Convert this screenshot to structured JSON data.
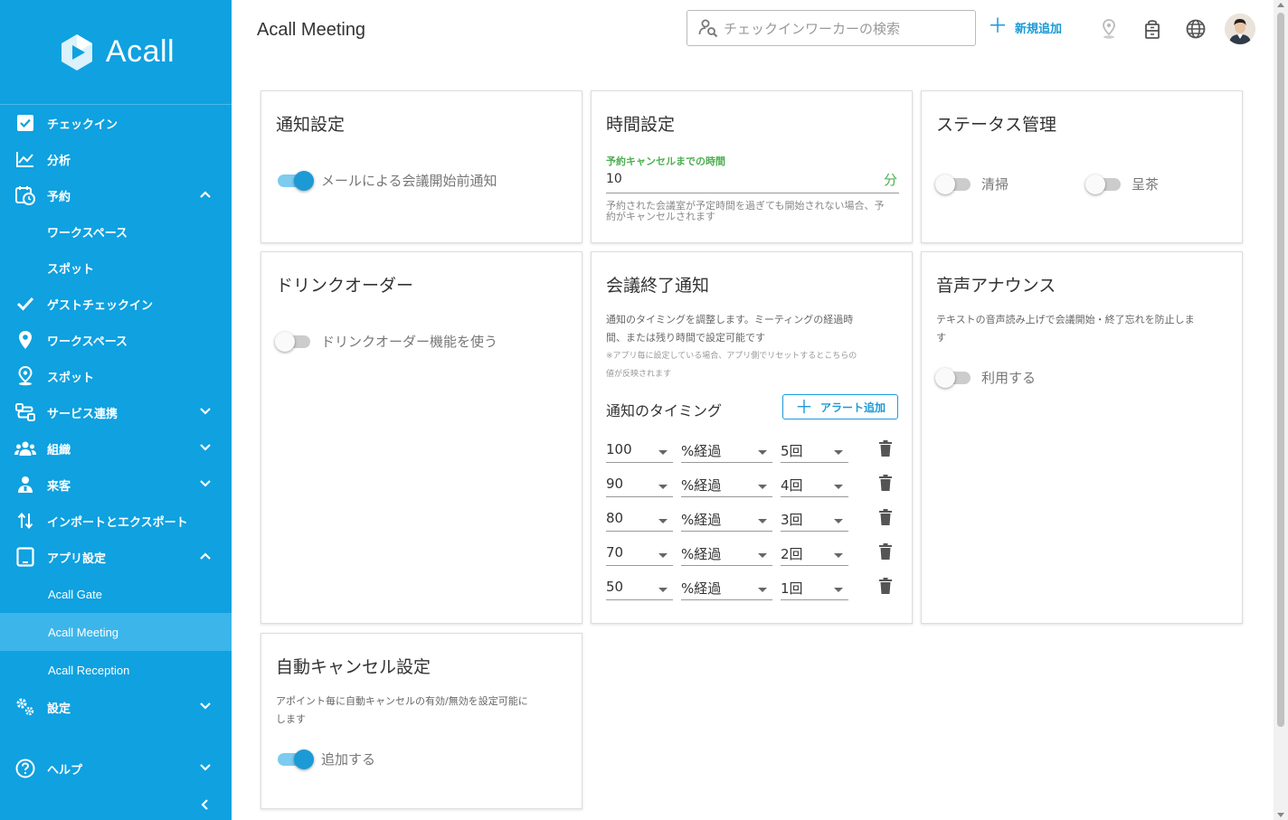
{
  "brand": {
    "name": "Acall",
    "color": "#0fa1e0"
  },
  "sidebar": {
    "items": [
      {
        "label": "チェックイン",
        "icon": "checkbox-icon"
      },
      {
        "label": "分析",
        "icon": "chart-line-icon"
      },
      {
        "label": "予約",
        "icon": "calendar-clock-icon",
        "expanded": true
      },
      {
        "label": "ワークスペース",
        "sub": true
      },
      {
        "label": "スポット",
        "sub": true
      },
      {
        "label": "ゲストチェックイン",
        "icon": "check-icon"
      },
      {
        "label": "ワークスペース",
        "icon": "map-pin-icon"
      },
      {
        "label": "スポット",
        "icon": "spot-pin-icon"
      },
      {
        "label": "サービス連携",
        "icon": "integration-icon",
        "expanded": false
      },
      {
        "label": "組織",
        "icon": "group-icon",
        "expanded": false
      },
      {
        "label": "来客",
        "icon": "visitor-icon",
        "expanded": false
      },
      {
        "label": "インポートとエクスポート",
        "icon": "import-export-icon"
      },
      {
        "label": "アプリ設定",
        "icon": "tablet-icon",
        "expanded": true
      },
      {
        "label": "Acall Gate",
        "sub2": true
      },
      {
        "label": "Acall Meeting",
        "sub2": true,
        "active": true
      },
      {
        "label": "Acall Reception",
        "sub2": true
      },
      {
        "label": "設定",
        "icon": "gears-icon",
        "expanded": false
      }
    ],
    "help": "ヘルプ"
  },
  "header": {
    "title": "Acall Meeting",
    "search_placeholder": "チェックインワーカーの検索",
    "add_new": "新規追加"
  },
  "cards": {
    "notify": {
      "title": "通知設定",
      "toggle_label": "メールによる会議開始前通知",
      "toggle_on": true
    },
    "time": {
      "title": "時間設定",
      "field_label": "予約キャンセルまでの時間",
      "field_value": "10",
      "suffix": "分",
      "help": "予約された会議室が予定時間を過ぎても開始されない場合、予約がキャンセルされます"
    },
    "status": {
      "title": "ステータス管理",
      "toggle1": "清掃",
      "toggle2": "呈茶"
    },
    "drink": {
      "title": "ドリンクオーダー",
      "toggle_label": "ドリンクオーダー機能を使う"
    },
    "end_notify": {
      "title": "会議終了通知",
      "desc1": "通知のタイミングを調整します。ミーティングの経過時",
      "desc2": "間、または残り時間で設定可能です",
      "note1": "※アプリ毎に設定している場合、アプリ側でリセットするとこちらの",
      "note2": "値が反映されます",
      "timing_label": "通知のタイミング",
      "alert_add": "アラート追加",
      "rows": [
        {
          "value": "100",
          "mode": "%経過",
          "count": "5回"
        },
        {
          "value": "90",
          "mode": "%経過",
          "count": "4回"
        },
        {
          "value": "80",
          "mode": "%経過",
          "count": "3回"
        },
        {
          "value": "70",
          "mode": "%経過",
          "count": "2回"
        },
        {
          "value": "50",
          "mode": "%経過",
          "count": "1回"
        }
      ]
    },
    "voice": {
      "title": "音声アナウンス",
      "desc1": "テキストの音声読み上げで会議開始・終了忘れを防止しま",
      "desc2": "す",
      "toggle_label": "利用する"
    },
    "auto_cancel": {
      "title": "自動キャンセル設定",
      "desc1": "アポイント毎に自動キャンセルの有効/無効を設定可能に",
      "desc2": "します",
      "toggle_label": "追加する",
      "toggle_on": true
    }
  }
}
